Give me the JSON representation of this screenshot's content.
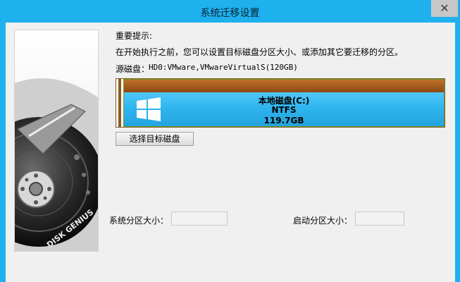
{
  "window": {
    "title": "系统迁移设置",
    "close_glyph": "✕"
  },
  "sidebar": {
    "logo_text": "DISK GENIUS"
  },
  "main": {
    "notice_title": "重要提示:",
    "notice_text": "在开始执行之前，您可以设置目标磁盘分区大小、或添加其它要迁移的分区。",
    "source_label": "源磁盘：",
    "source_value": "HD0:VMware,VMwareVirtualS(120GB)",
    "partition": {
      "name": "本地磁盘(C:)",
      "fs": "NTFS",
      "size": "119.7GB"
    },
    "select_button": "选择目标磁盘",
    "system_size_label": "系统分区大小：",
    "system_size_value": "",
    "boot_size_label": "启动分区大小：",
    "boot_size_value": ""
  },
  "colors": {
    "titlebar": "#1fb0ee",
    "partition_fill": "#2fb5ee",
    "partition_bar": "#a65f1f"
  }
}
